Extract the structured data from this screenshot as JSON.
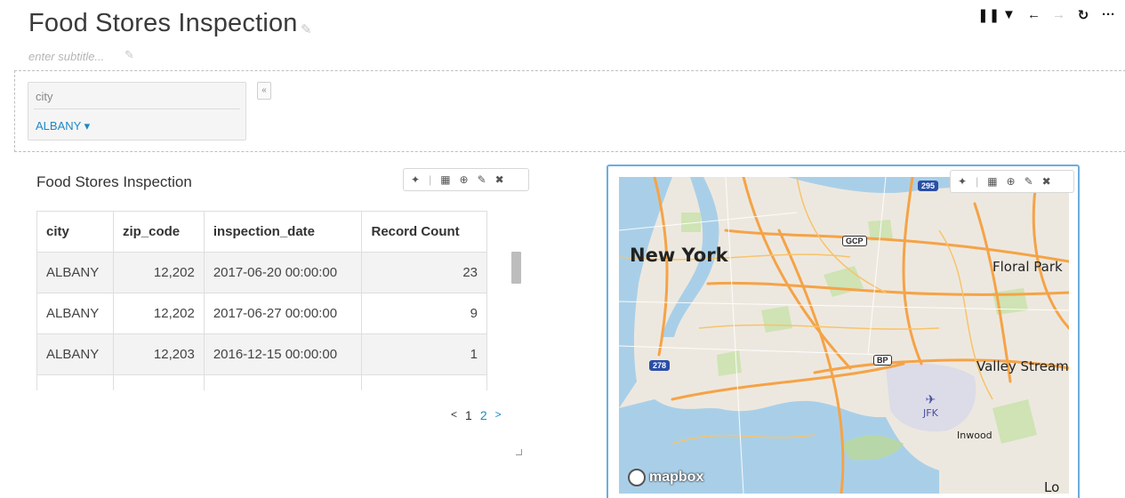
{
  "dashboard": {
    "title": "Food Stores Inspection",
    "subtitle_placeholder": "enter subtitle..."
  },
  "toolbar": {
    "icons": [
      "pause-icon",
      "filter-icon",
      "back-arrow-icon",
      "forward-arrow-icon",
      "refresh-icon",
      "more-icon"
    ],
    "glyphs": {
      "pause": "❚❚",
      "filter": "▼",
      "back": "←",
      "forward": "→",
      "refresh": "↻",
      "more": "···"
    }
  },
  "filter": {
    "label": "city",
    "value": "ALBANY ▾",
    "collapse": "«"
  },
  "table_panel": {
    "title": "Food Stores Inspection",
    "columns": [
      "city",
      "zip_code",
      "inspection_date",
      "Record Count"
    ],
    "rows": [
      [
        "ALBANY",
        "12,202",
        "2017-06-20 00:00:00",
        "23"
      ],
      [
        "ALBANY",
        "12,202",
        "2017-06-27 00:00:00",
        "9"
      ],
      [
        "ALBANY",
        "12,203",
        "2016-12-15 00:00:00",
        "1"
      ]
    ],
    "pagination": {
      "prev": "<",
      "pages": [
        "1",
        "2"
      ],
      "current": "2",
      "next": ">"
    }
  },
  "panel_toolbar": {
    "sparkle": "✦",
    "divider": "|",
    "grid": "▦",
    "download": "⊕",
    "edit": "✎",
    "close": "✖"
  },
  "map": {
    "labels": {
      "new_york": "New York",
      "floral_park": "Floral Park",
      "valley_stream": "Valley Stream",
      "jfk": "JFK",
      "inwood": "Inwood",
      "lo": "Lo"
    },
    "shields": {
      "i295": "295",
      "gcp": "GCP",
      "bp": "BP",
      "i278": "278"
    },
    "attribution": "mapbox"
  },
  "colors": {
    "accent": "#1e88c7",
    "map_panel_border": "#6aaee0",
    "water": "#a9cfe8",
    "highway": "#f5a347",
    "park": "#cfe3b4"
  }
}
